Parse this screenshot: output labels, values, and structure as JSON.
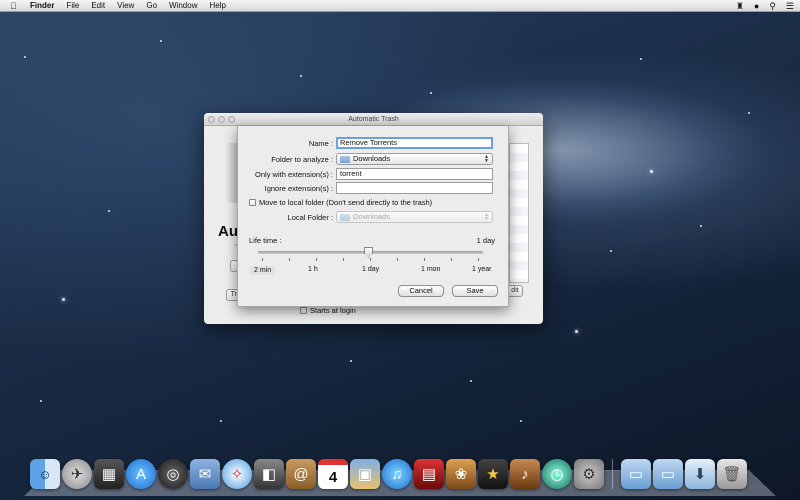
{
  "menubar": {
    "apple": "",
    "items": [
      "Finder",
      "File",
      "Edit",
      "View",
      "Go",
      "Window",
      "Help"
    ]
  },
  "back_window": {
    "title": "Automatic Trash",
    "heading_partial": "Au",
    "subheading_partial": "T",
    "settings_button": "Trash Settings",
    "edit_button": "dit",
    "starts_at_login": "Starts at login"
  },
  "sheet": {
    "name_label": "Name :",
    "name_value": "Remove Torrents",
    "folder_label": "Folder to analyze :",
    "folder_value": "Downloads",
    "only_ext_label": "Only with extension(s) :",
    "only_ext_value": "torrent",
    "ignore_ext_label": "Ignore extension(s) :",
    "ignore_ext_value": "",
    "move_local_label": "Move to local folder (Don't send directly to the trash)",
    "local_folder_label": "Local Folder :",
    "local_folder_value": "Downloads",
    "lifetime_label": "Life time :",
    "lifetime_value": "1 day",
    "lifetime_fraction": 0.5,
    "slider_labels": [
      "2 min",
      "1 h",
      "1 day",
      "1 mon",
      "1 year"
    ],
    "cancel_label": "Cancel",
    "save_label": "Save"
  },
  "dock": {
    "icons": [
      "finder-icon",
      "launchpad-icon",
      "mission-control-icon",
      "app-store-icon",
      "dashboard-icon",
      "mail-icon",
      "safari-icon",
      "facetime-icon",
      "contacts-icon",
      "calendar-icon",
      "preview-icon",
      "itunes-icon",
      "photo-booth-icon",
      "iphoto-icon",
      "imovie-icon",
      "garageband-icon",
      "time-machine-icon",
      "system-preferences-icon",
      "applications-folder-icon",
      "documents-folder-icon",
      "downloads-folder-icon",
      "trash-icon"
    ],
    "calendar_day": "4"
  }
}
